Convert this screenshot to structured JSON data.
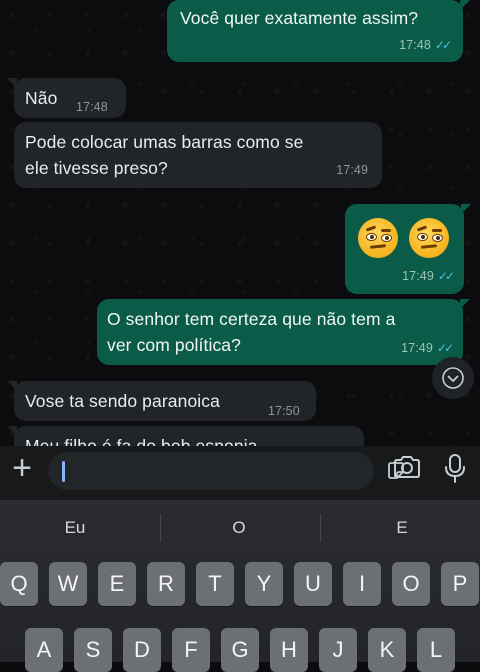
{
  "messages": [
    {
      "direction": "out",
      "text": "Você quer exatamente assim?",
      "time": "17:48",
      "status": "read"
    },
    {
      "direction": "in",
      "text": "Não",
      "time": "17:48"
    },
    {
      "direction": "in",
      "text": "Pode colocar umas barras como se ele tivesse preso?",
      "time": "17:49"
    },
    {
      "direction": "out",
      "emojis": [
        "face-with-raised-eyebrow",
        "face-with-raised-eyebrow"
      ],
      "time": "17:49",
      "status": "read"
    },
    {
      "direction": "out",
      "text": "O senhor tem certeza que não tem a ver com política?",
      "time": "17:49",
      "status": "read"
    },
    {
      "direction": "in",
      "text": "Vose ta sendo paranoica",
      "time": "17:50"
    },
    {
      "direction": "in",
      "text": "Meu filho é fa do bob esponja",
      "time": ""
    }
  ],
  "message_lines": {
    "m3_line1": "Pode colocar umas barras como se",
    "m3_line2": "ele tivesse preso?",
    "m5_line1": "O senhor tem certeza que não tem a",
    "m5_line2": "ver com política?"
  },
  "composer": {
    "value": "",
    "icons": [
      "plus-icon",
      "sticker-icon",
      "camera-icon",
      "microphone-icon"
    ]
  },
  "keyboard": {
    "suggestions": [
      "Eu",
      "O",
      "E"
    ],
    "row1": [
      "Q",
      "W",
      "E",
      "R",
      "T",
      "Y",
      "U",
      "I",
      "O",
      "P"
    ],
    "row2": [
      "A",
      "S",
      "D",
      "F",
      "G",
      "H",
      "J",
      "K",
      "L"
    ]
  },
  "colors": {
    "outgoing_bubble": "#0a5c48",
    "incoming_bubble": "#222527",
    "read_ticks": "#53bdeb",
    "cursor": "#8ab4f8"
  }
}
